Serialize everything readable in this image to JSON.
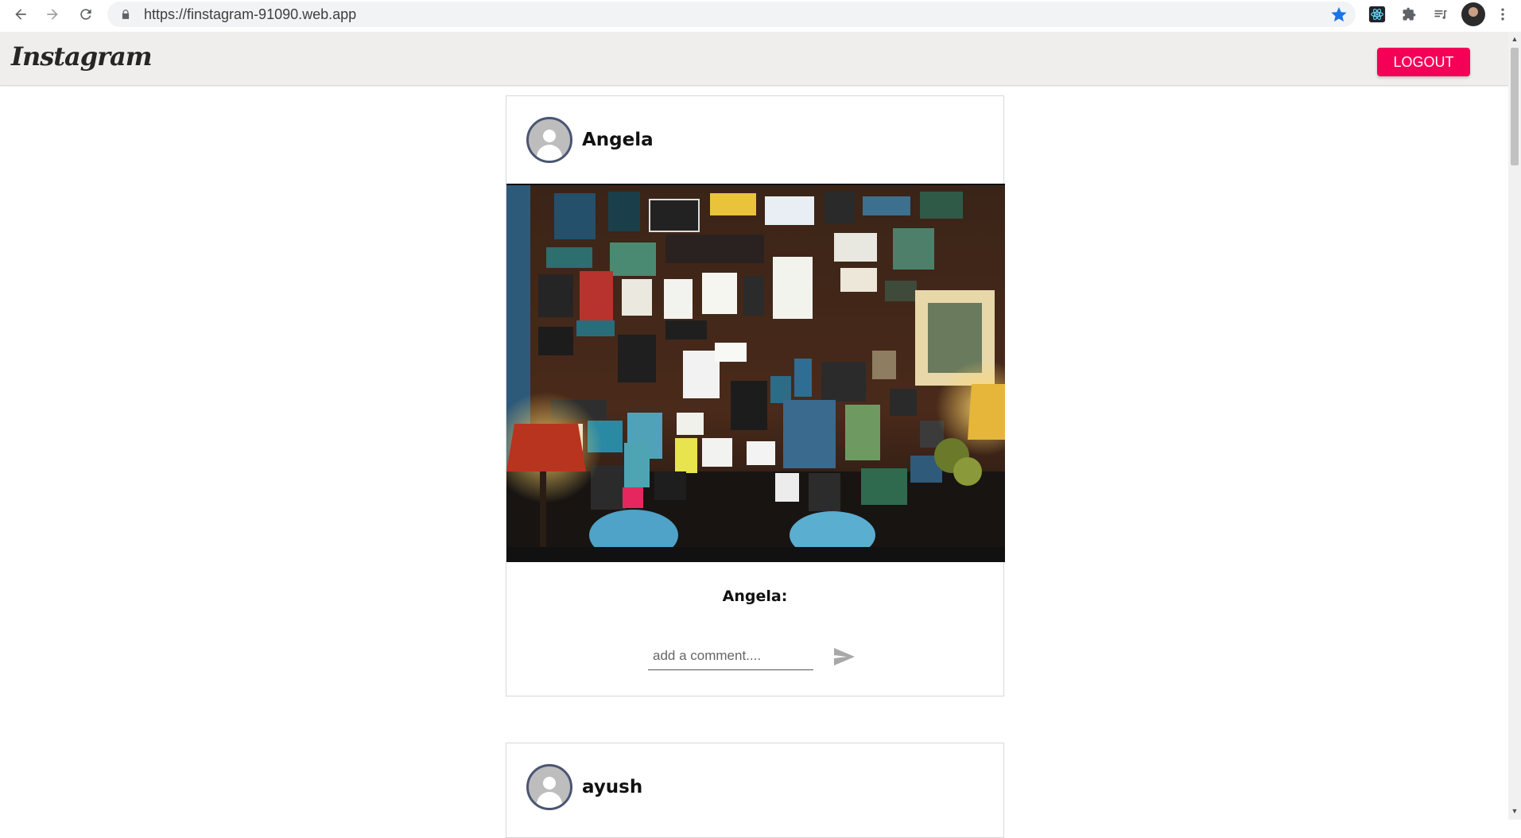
{
  "browser": {
    "url": "https://finstagram-91090.web.app"
  },
  "app": {
    "logo": "Instagram",
    "logout_label": "LOGOUT"
  },
  "posts": [
    {
      "username": "Angela",
      "caption": "Angela:",
      "comment_placeholder": "add a comment...."
    },
    {
      "username": "ayush"
    }
  ],
  "colors": {
    "logout_bg": "#f50057",
    "appbar_bg": "#f0eeec",
    "avatar_ring": "#4b5573"
  },
  "icons": [
    "back-arrow-icon",
    "forward-arrow-icon",
    "reload-icon",
    "lock-icon",
    "star-icon",
    "react-devtools-icon",
    "extensions-icon",
    "reading-list-icon",
    "menu-dots-icon",
    "person-avatar-icon",
    "send-icon"
  ]
}
